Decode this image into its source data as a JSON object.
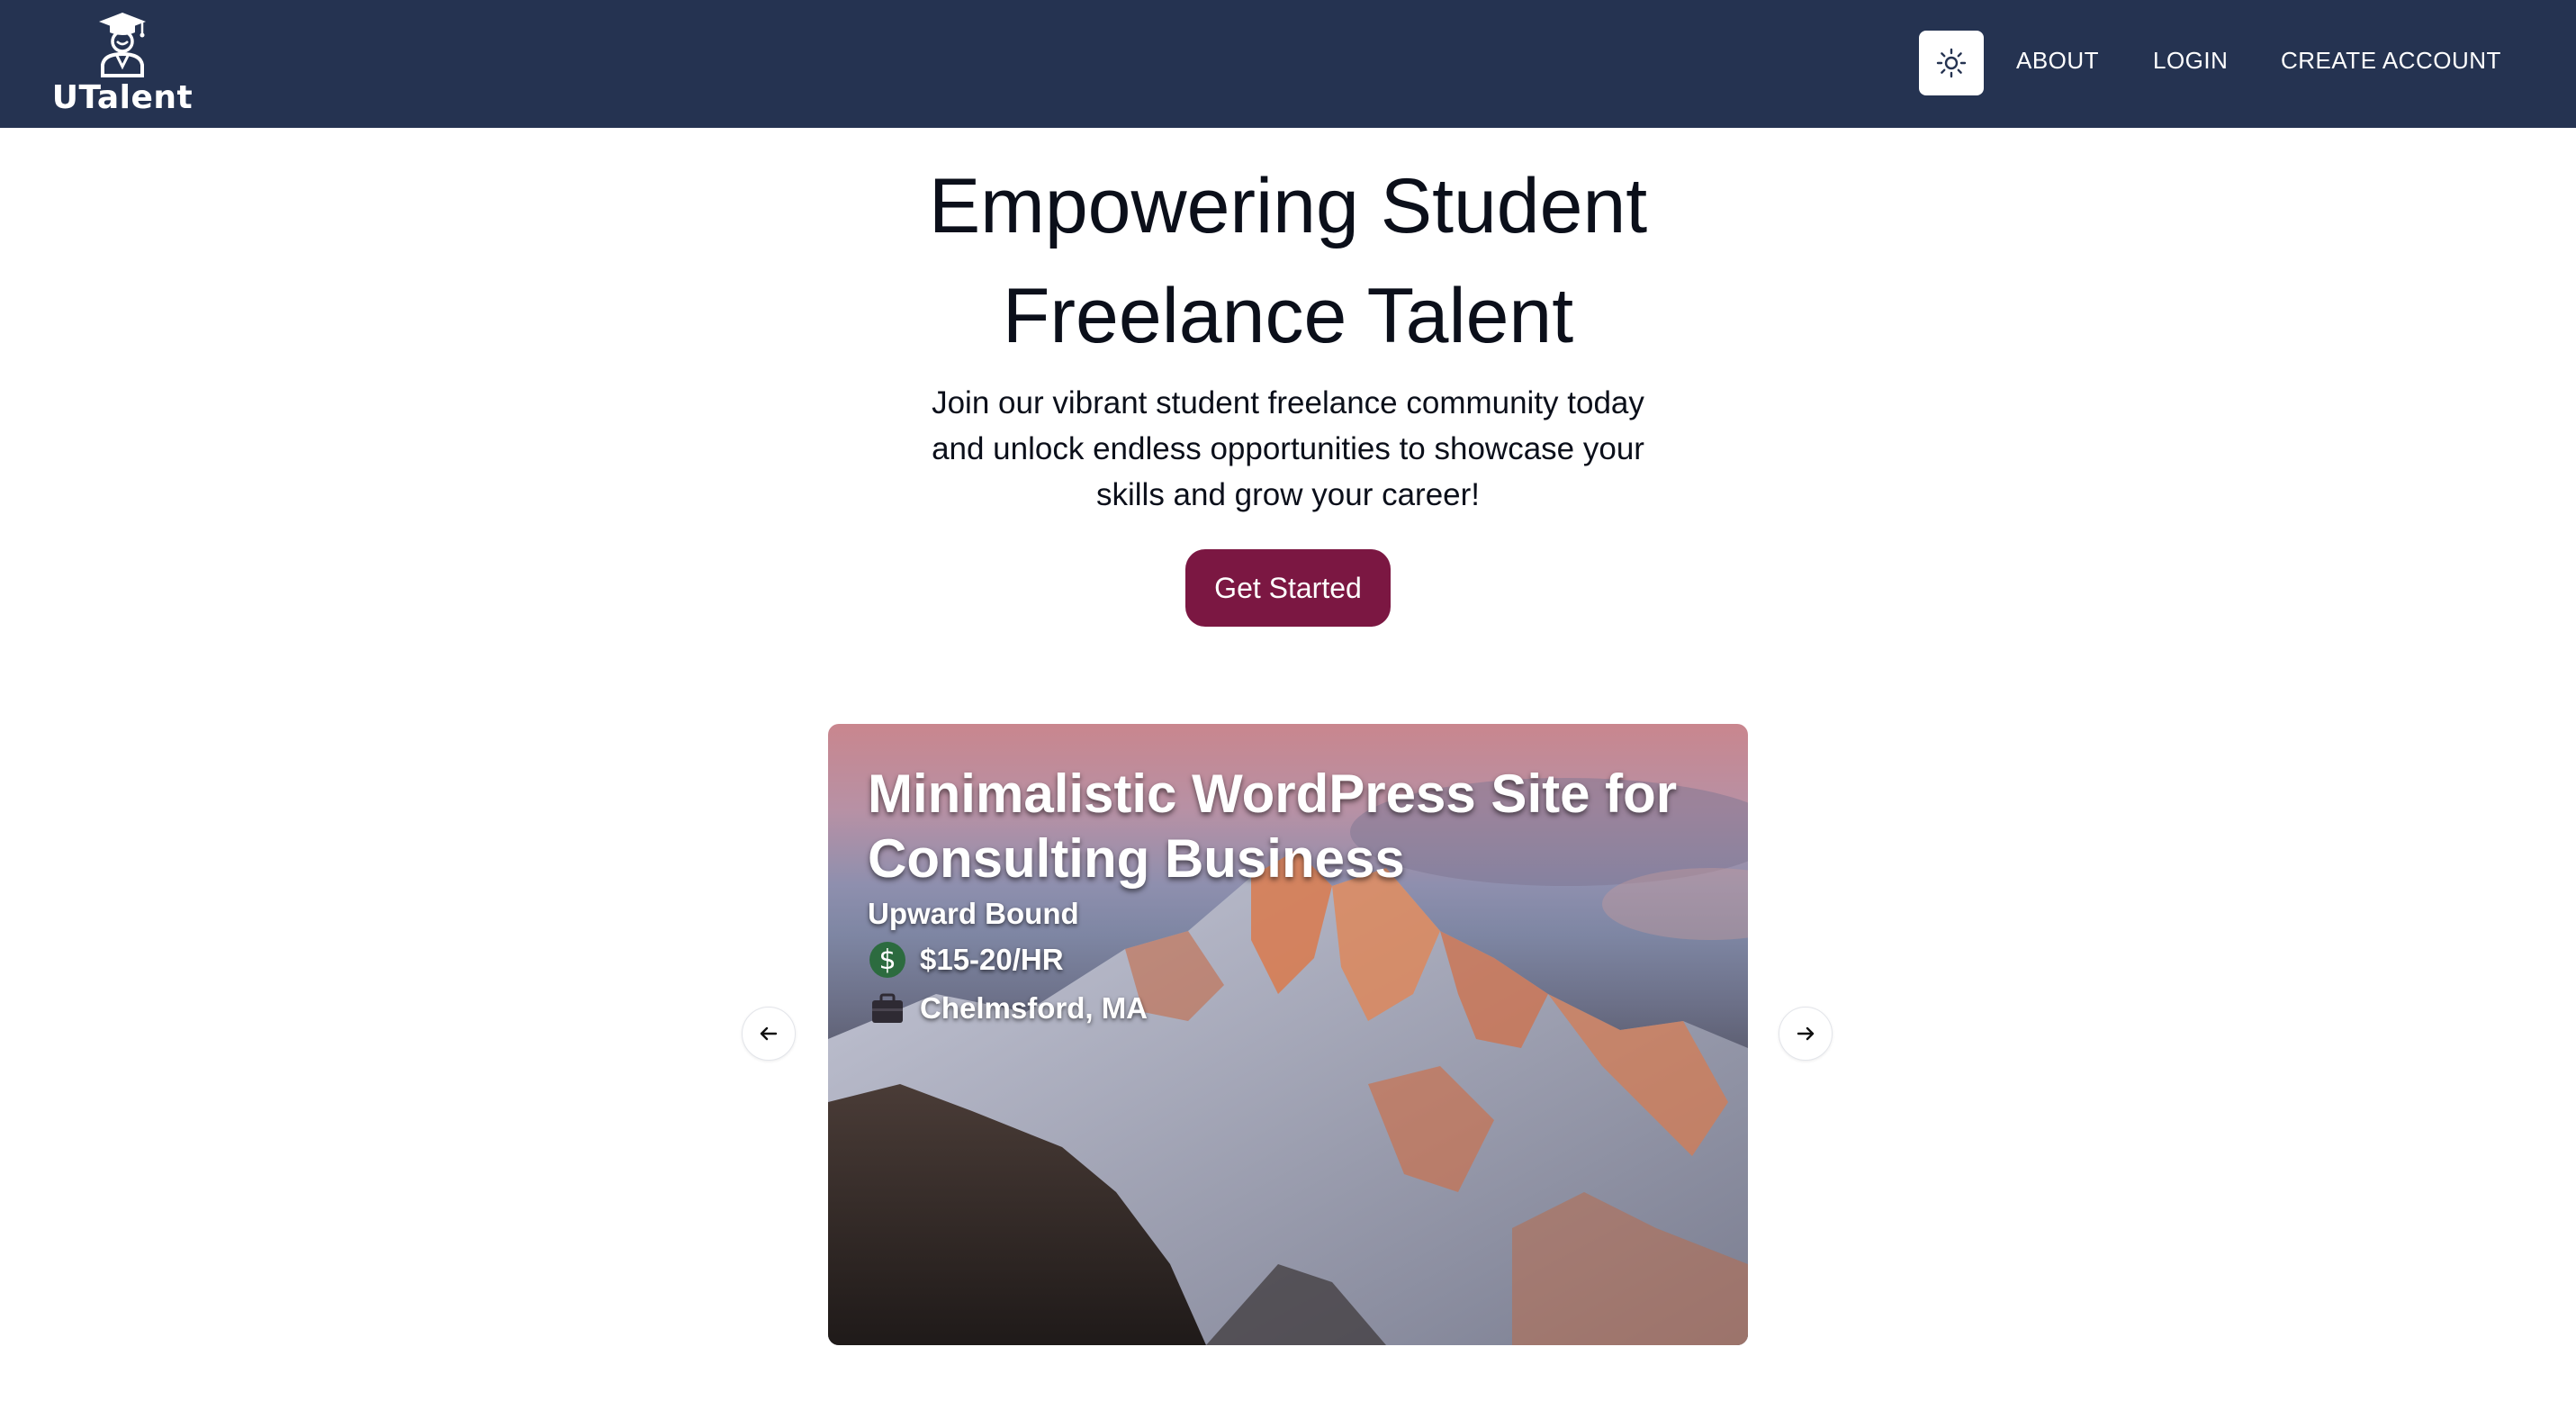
{
  "header": {
    "logo_text": "UTalent",
    "nav": {
      "about": "ABOUT",
      "login": "LOGIN",
      "create_account": "CREATE ACCOUNT"
    },
    "colors": {
      "background": "#253351",
      "theme_button": "#ffffff"
    },
    "theme_toggle_icon": "sun-icon"
  },
  "hero": {
    "title": "Empowering Student Freelance Talent",
    "subtitle": "Join our vibrant student freelance community today and unlock endless opportunities to showcase your skills and grow your career!",
    "cta_label": "Get Started",
    "cta_color": "#7b1742"
  },
  "carousel": {
    "current_card": {
      "title": "Minimalistic WordPress Site for Consulting Business",
      "company": "Upward Bound",
      "pay": "$15-20/HR",
      "location": "Chelmsford, MA",
      "pay_icon": "dollar-icon",
      "location_icon": "briefcase-icon"
    },
    "prev_icon": "arrow-left-icon",
    "next_icon": "arrow-right-icon"
  }
}
